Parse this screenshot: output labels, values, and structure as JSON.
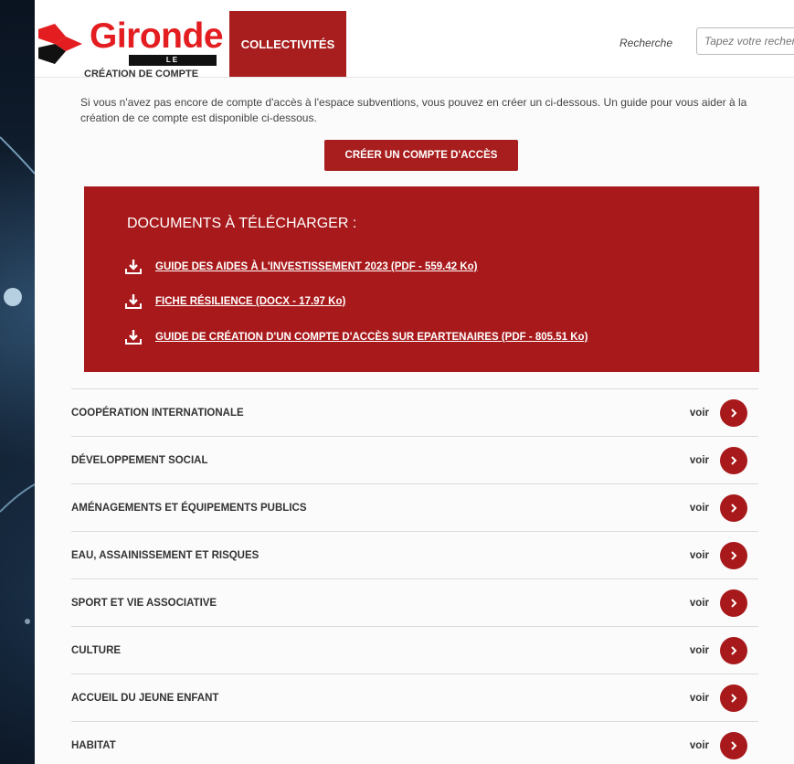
{
  "header": {
    "logo_word": "Gironde",
    "logo_sub": "LE DÉPARTEMENT",
    "nav_tab": "COLLECTIVITÉS",
    "search_label": "Recherche",
    "search_placeholder": "Tapez votre recherche"
  },
  "section": {
    "heading": "CRÉATION DE COMPTE",
    "intro": "Si vous n'avez pas encore de compte d'accès à l'espace subventions, vous pouvez en créer un ci-dessous. Un guide pour vous aider à la création de ce compte est disponible ci-dessous.",
    "cta_label": "CRÉER UN COMPTE D'ACCÈS"
  },
  "documents": {
    "title": "DOCUMENTS À TÉLÉCHARGER :",
    "items": [
      {
        "label": "GUIDE DES AIDES À L'INVESTISSEMENT 2023 (PDF - 559.42 Ko)"
      },
      {
        "label": "FICHE RÉSILIENCE (DOCX - 17.97 Ko)"
      },
      {
        "label": "GUIDE DE CRÉATION D'UN COMPTE D'ACCÈS SUR EPARTENAIRES (PDF - 805.51 Ko)"
      }
    ]
  },
  "accordion": {
    "voir_label": "voir",
    "items": [
      {
        "label": "COOPÉRATION INTERNATIONALE"
      },
      {
        "label": "DÉVELOPPEMENT SOCIAL"
      },
      {
        "label": "AMÉNAGEMENTS ET ÉQUIPEMENTS PUBLICS"
      },
      {
        "label": "EAU, ASSAINISSEMENT ET RISQUES"
      },
      {
        "label": "SPORT ET VIE ASSOCIATIVE"
      },
      {
        "label": "CULTURE"
      },
      {
        "label": "ACCUEIL DU JEUNE ENFANT"
      },
      {
        "label": "HABITAT"
      }
    ]
  },
  "colors": {
    "brand_red": "#a8191b",
    "logo_red": "#e31d20"
  },
  "icons": {
    "download": "download-icon",
    "chevron": "chevron-right-icon"
  }
}
